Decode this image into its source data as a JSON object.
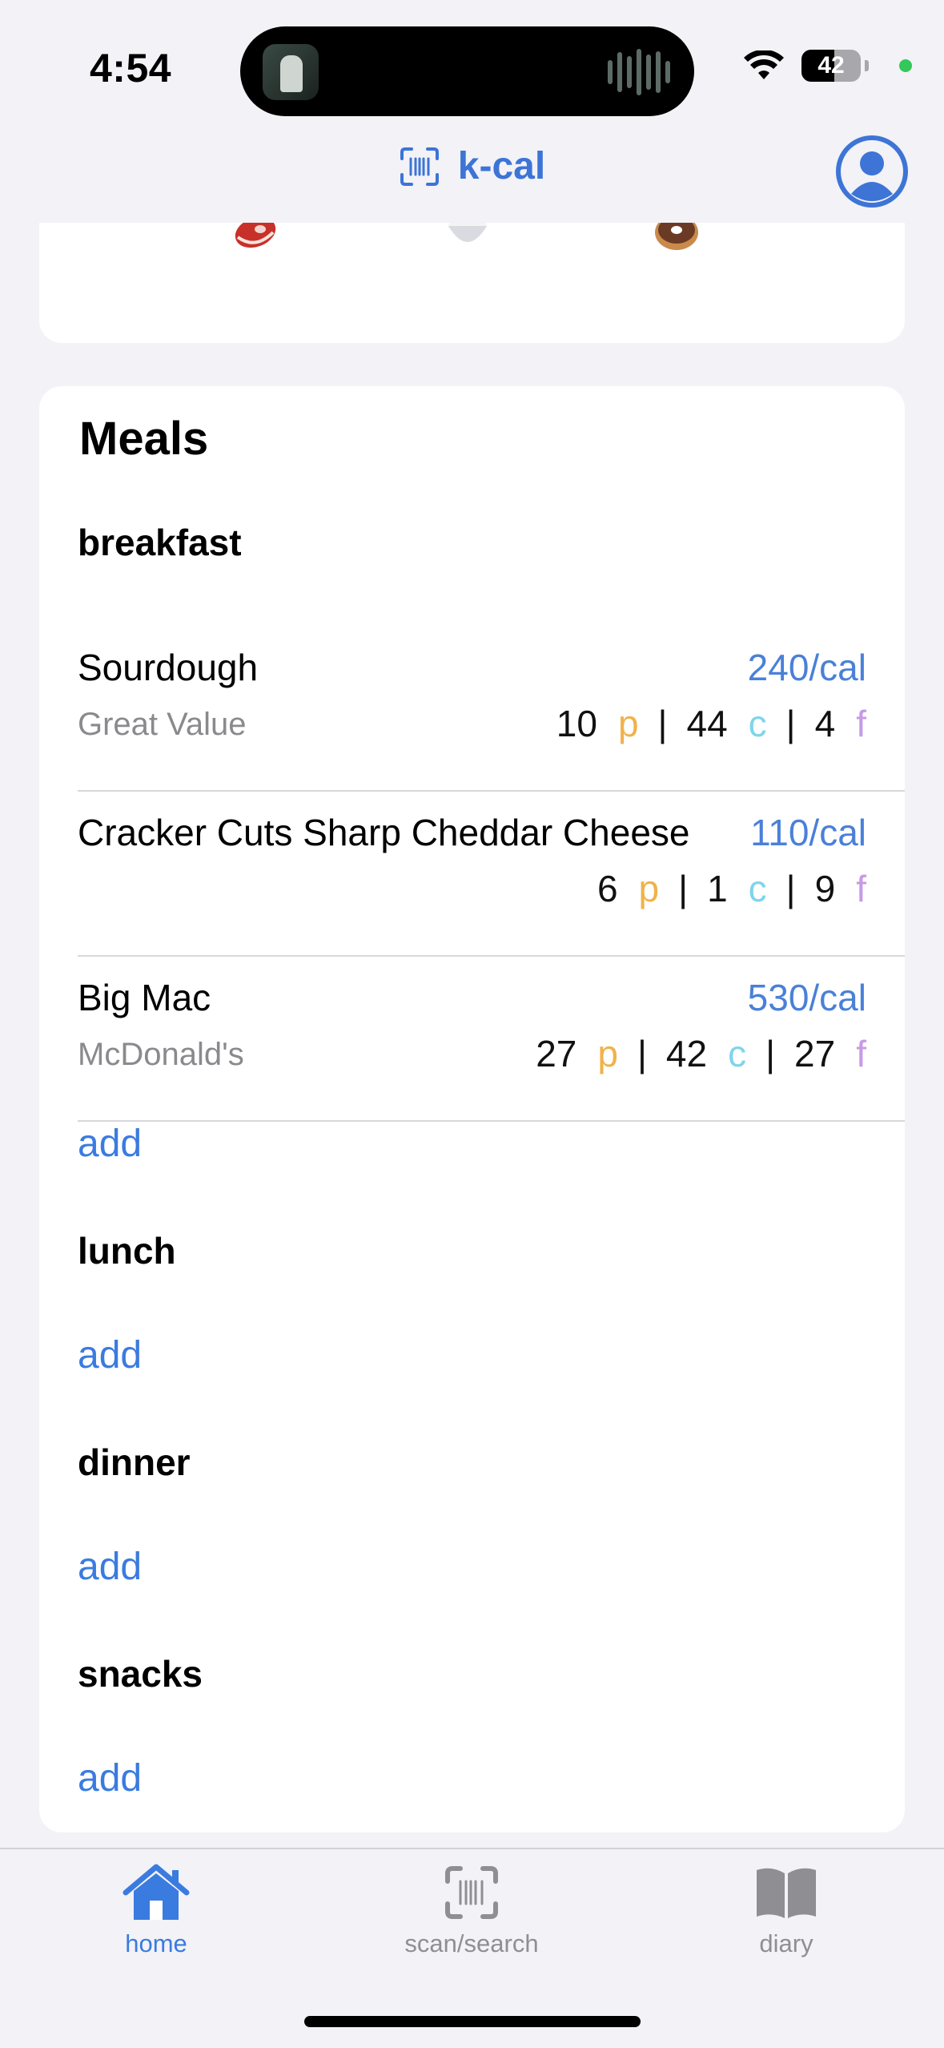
{
  "status_bar": {
    "time": "4:54",
    "battery": "42",
    "icons": [
      "now-playing-art-icon",
      "audio-waveform-icon",
      "wifi-icon",
      "battery-icon",
      "privacy-indicator-dot"
    ]
  },
  "header": {
    "title": "k-cal",
    "title_icon": "barcode-scan-icon",
    "profile_icon": "person-circle-icon",
    "accent_color": "#3d74d6"
  },
  "macro_icons": [
    "steak-emoji-icon",
    "rice-bowl-emoji-icon",
    "donut-emoji-icon"
  ],
  "meals": {
    "title": "Meals",
    "sections": [
      {
        "name": "breakfast",
        "items": [
          {
            "name": "Sourdough",
            "brand": "Great Value",
            "calories": "240/cal",
            "protein": "10",
            "carbs": "44",
            "fat": "4"
          },
          {
            "name": "Cracker Cuts Sharp Cheddar Cheese",
            "brand": "",
            "calories": "110/cal",
            "protein": "6",
            "carbs": "1",
            "fat": "9"
          },
          {
            "name": "Big Mac",
            "brand": "McDonald's",
            "calories": "530/cal",
            "protein": "27",
            "carbs": "42",
            "fat": "27"
          }
        ],
        "add_label": "add"
      },
      {
        "name": "lunch",
        "items": [],
        "add_label": "add"
      },
      {
        "name": "dinner",
        "items": [],
        "add_label": "add"
      },
      {
        "name": "snacks",
        "items": [],
        "add_label": "add"
      }
    ],
    "macro_letters": {
      "protein": "p",
      "carbs": "c",
      "fat": "f"
    },
    "macro_colors": {
      "protein": "#f0b24a",
      "carbs": "#7fd5ec",
      "fat": "#c79ae6"
    },
    "separator": "|"
  },
  "tab_bar": {
    "tabs": [
      {
        "label": "home",
        "icon": "house-icon",
        "active": true
      },
      {
        "label": "scan/search",
        "icon": "barcode-viewfinder-icon",
        "active": false
      },
      {
        "label": "diary",
        "icon": "book-icon",
        "active": false
      }
    ]
  }
}
